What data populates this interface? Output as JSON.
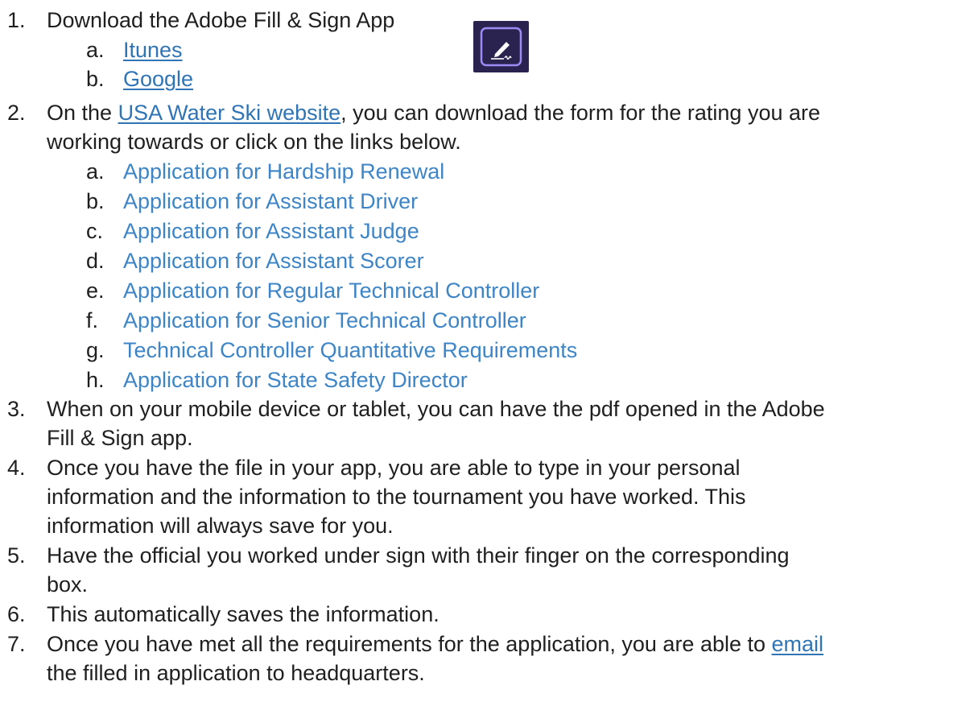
{
  "steps": [
    {
      "number": "1.",
      "text": "Download the Adobe Fill & Sign App",
      "icon": "adobe-fill-sign-app-icon",
      "sub": [
        {
          "letter": "a.",
          "label": "Itunes"
        },
        {
          "letter": "b.",
          "label": "Google"
        }
      ]
    },
    {
      "number": "2.",
      "before": "On the ",
      "link": "USA Water Ski website",
      "after": ", you can download the form for the rating you are",
      "line2": "working towards or click on the links below.",
      "sub": [
        {
          "letter": "a.",
          "label": "Application for Hardship Renewal"
        },
        {
          "letter": "b.",
          "label": "Application for Assistant Driver"
        },
        {
          "letter": "c.",
          "label": "Application for Assistant Judge"
        },
        {
          "letter": "d.",
          "label": "Application for Assistant Scorer"
        },
        {
          "letter": "e.",
          "label": "Application for Regular Technical Controller"
        },
        {
          "letter": "f.",
          "label": "Application for Senior Technical Controller"
        },
        {
          "letter": "g.",
          "label": "Technical Controller Quantitative Requirements"
        },
        {
          "letter": "h.",
          "label": "Application for State Safety Director"
        }
      ]
    },
    {
      "number": "3.",
      "line1": "When on your mobile device or tablet, you can have the pdf opened in the Adobe",
      "line2": "Fill & Sign app."
    },
    {
      "number": "4.",
      "line1": "Once you have the file in your app, you are able to type in your personal",
      "line2": "information and the information to the tournament you have worked.  This",
      "line3": "information will always save for you."
    },
    {
      "number": "5.",
      "line1": "Have the official you worked under sign with their finger on the corresponding",
      "line2": "box."
    },
    {
      "number": "6.",
      "line1": "This automatically saves the information."
    },
    {
      "number": "7.",
      "before": "Once you have met all the requirements for the application, you are able to ",
      "link": "email",
      "line2": "the filled in application to headquarters."
    }
  ],
  "colors": {
    "text": "#1f1f1f",
    "underlined_link": "#2f74b5",
    "plain_link": "#3d85c6",
    "icon_background": "#2a2350",
    "icon_accent": "#9b8cf5"
  }
}
